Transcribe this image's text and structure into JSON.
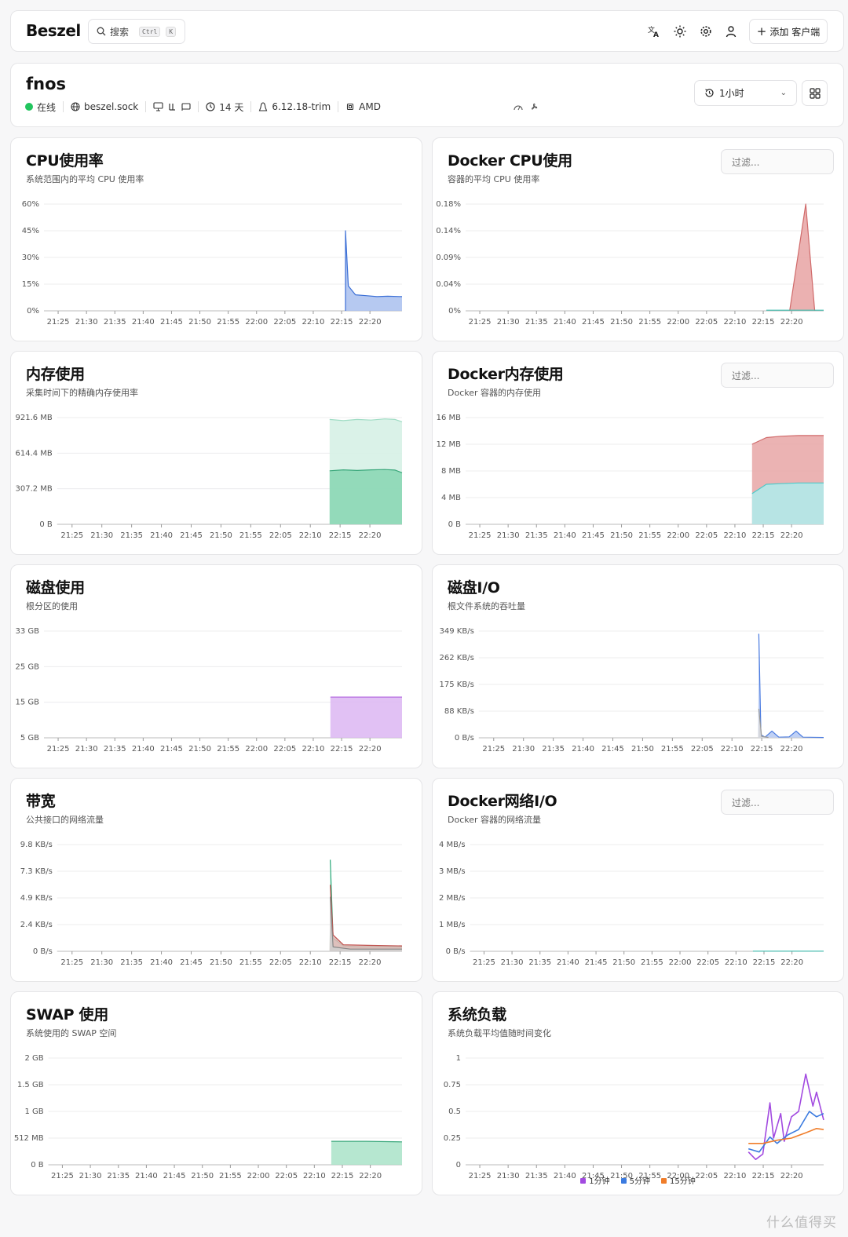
{
  "topbar": {
    "logo": "Beszel",
    "search_label": "搜索",
    "search_kbd_ctrl": "Ctrl",
    "search_kbd_k": "K",
    "add_client_label": "添加 客户端"
  },
  "system": {
    "hostname": "fnos",
    "status": "在线",
    "connection": "beszel.sock",
    "uptime": "14 天",
    "kernel": "6.12.18-trim",
    "cpu": "AMD",
    "time_range": "1小时"
  },
  "watermark": "什么值得买",
  "charts": [
    {
      "id": "cpu",
      "title": "CPU使用率",
      "subtitle": "系统范围内的平均 CPU 使用率",
      "filter": null
    },
    {
      "id": "docker_cpu",
      "title": "Docker CPU使用",
      "subtitle": "容器的平均 CPU 使用率",
      "filter": "过滤..."
    },
    {
      "id": "mem",
      "title": "内存使用",
      "subtitle": "采集时间下的精确内存使用率",
      "filter": null
    },
    {
      "id": "docker_mem",
      "title": "Docker内存使用",
      "subtitle": "Docker 容器的内存使用",
      "filter": "过滤..."
    },
    {
      "id": "disk",
      "title": "磁盘使用",
      "subtitle": "根分区的使用",
      "filter": null
    },
    {
      "id": "disk_io",
      "title": "磁盘I/O",
      "subtitle": "根文件系统的吞吐量",
      "filter": null
    },
    {
      "id": "bandwidth",
      "title": "带宽",
      "subtitle": "公共接口的网络流量",
      "filter": null
    },
    {
      "id": "docker_net",
      "title": "Docker网络I/O",
      "subtitle": "Docker 容器的网络流量",
      "filter": "过滤..."
    },
    {
      "id": "swap",
      "title": "SWAP 使用",
      "subtitle": "系统使用的 SWAP 空间",
      "filter": null
    },
    {
      "id": "load",
      "title": "系统负载",
      "subtitle": "系统负载平均值随时间变化",
      "filter": null
    }
  ],
  "chart_data": [
    {
      "type": "area",
      "id": "cpu",
      "xticks": [
        "21:25",
        "21:30",
        "21:35",
        "21:40",
        "21:45",
        "21:50",
        "21:55",
        "22:00",
        "22:05",
        "22:10",
        "22:15",
        "22:20"
      ],
      "yticks": [
        "60%",
        "45%",
        "30%",
        "15%",
        "0%"
      ],
      "ylim": [
        0,
        60
      ],
      "series": [
        {
          "color": "#3b6fd6",
          "fill": "#a9c0ee",
          "points": [
            [
              0.0,
              0
            ],
            [
              0.842,
              0
            ],
            [
              0.842,
              45
            ],
            [
              0.85,
              14
            ],
            [
              0.87,
              9
            ],
            [
              0.9,
              8.5
            ],
            [
              0.93,
              8
            ],
            [
              0.96,
              8.2
            ],
            [
              1.0,
              8
            ],
            [
              1.0,
              0
            ]
          ]
        }
      ]
    },
    {
      "type": "area",
      "id": "docker_cpu",
      "xticks": [
        "21:25",
        "21:30",
        "21:35",
        "21:40",
        "21:45",
        "21:50",
        "21:55",
        "22:00",
        "22:05",
        "22:10",
        "22:15",
        "22:20"
      ],
      "yticks": [
        "0.18%",
        "0.14%",
        "0.09%",
        "0.04%",
        "0%"
      ],
      "ylim": [
        0,
        0.18
      ],
      "series": [
        {
          "color": "#d06a6a",
          "fill": "#e8a3a3",
          "points": [
            [
              0.88,
              0
            ],
            [
              0.905,
              0
            ],
            [
              0.95,
              0.18
            ],
            [
              0.975,
              0
            ],
            [
              1.0,
              0
            ]
          ]
        },
        {
          "color": "#3fbfb0",
          "fill": "none",
          "points": [
            [
              0.84,
              0.001
            ],
            [
              1.0,
              0.001
            ]
          ]
        }
      ]
    },
    {
      "type": "area",
      "id": "mem",
      "xticks": [
        "21:25",
        "21:30",
        "21:35",
        "21:40",
        "21:45",
        "21:50",
        "21:55",
        "22:05",
        "22:10",
        "22:15",
        "22:20"
      ],
      "yticks": [
        "921.6 MB",
        "614.4 MB",
        "307.2 MB",
        "0 B"
      ],
      "ylim": [
        0,
        921.6
      ],
      "series": [
        {
          "color": "#9fdcc4",
          "fill": "#d3f0e4",
          "points": [
            [
              0.79,
              0
            ],
            [
              0.79,
              905
            ],
            [
              0.83,
              895
            ],
            [
              0.87,
              905
            ],
            [
              0.91,
              900
            ],
            [
              0.95,
              910
            ],
            [
              0.98,
              905
            ],
            [
              1.0,
              885
            ],
            [
              1.0,
              0
            ]
          ]
        },
        {
          "color": "#3aa77b",
          "fill": "#86d6b1",
          "points": [
            [
              0.79,
              0
            ],
            [
              0.79,
              462
            ],
            [
              0.83,
              470
            ],
            [
              0.87,
              465
            ],
            [
              0.91,
              470
            ],
            [
              0.95,
              473
            ],
            [
              0.98,
              468
            ],
            [
              1.0,
              445
            ],
            [
              1.0,
              0
            ]
          ]
        }
      ]
    },
    {
      "type": "area",
      "id": "docker_mem",
      "xticks": [
        "21:25",
        "21:30",
        "21:35",
        "21:40",
        "21:45",
        "21:50",
        "21:55",
        "22:00",
        "22:05",
        "22:10",
        "22:15",
        "22:20"
      ],
      "yticks": [
        "16 MB",
        "12 MB",
        "8 MB",
        "4 MB",
        "0 B"
      ],
      "ylim": [
        0,
        16
      ],
      "series": [
        {
          "color": "#d06a6a",
          "fill": "#e8a6a6",
          "points": [
            [
              0.8,
              0
            ],
            [
              0.8,
              12
            ],
            [
              0.84,
              13
            ],
            [
              0.88,
              13.2
            ],
            [
              0.93,
              13.3
            ],
            [
              1.0,
              13.3
            ],
            [
              1.0,
              0
            ]
          ]
        },
        {
          "color": "#4fc9c9",
          "fill": "#aeecec",
          "points": [
            [
              0.8,
              0
            ],
            [
              0.8,
              4.6
            ],
            [
              0.84,
              6
            ],
            [
              0.88,
              6.1
            ],
            [
              0.93,
              6.2
            ],
            [
              1.0,
              6.2
            ],
            [
              1.0,
              0
            ]
          ]
        }
      ]
    },
    {
      "type": "area",
      "id": "disk",
      "xticks": [
        "21:25",
        "21:30",
        "21:35",
        "21:40",
        "21:45",
        "21:50",
        "21:55",
        "22:00",
        "22:05",
        "22:10",
        "22:15",
        "22:20"
      ],
      "yticks": [
        "33 GB",
        "25 GB",
        "15 GB",
        "5 GB"
      ],
      "ylim": [
        0,
        33
      ],
      "series": [
        {
          "color": "#b46be0",
          "fill": "#dcb6f2",
          "points": [
            [
              0.8,
              0
            ],
            [
              0.8,
              12.6
            ],
            [
              1.0,
              12.6
            ],
            [
              1.0,
              0
            ]
          ]
        }
      ]
    },
    {
      "type": "area",
      "id": "disk_io",
      "xticks": [
        "21:25",
        "21:30",
        "21:35",
        "21:40",
        "21:45",
        "21:50",
        "21:55",
        "22:05",
        "22:10",
        "22:15",
        "22:20"
      ],
      "yticks": [
        "349 KB/s",
        "262 KB/s",
        "175 KB/s",
        "88 KB/s",
        "0 B/s"
      ],
      "ylim": [
        0,
        349
      ],
      "series": [
        {
          "color": "#4a7be0",
          "fill": "#b5c9f3",
          "points": [
            [
              0.81,
              0
            ],
            [
              0.812,
              340
            ],
            [
              0.818,
              10
            ],
            [
              0.83,
              2
            ],
            [
              0.85,
              22
            ],
            [
              0.87,
              2
            ],
            [
              0.9,
              3
            ],
            [
              0.92,
              22
            ],
            [
              0.94,
              2
            ],
            [
              1.0,
              1
            ]
          ]
        },
        {
          "color": "#9a9a9a",
          "fill": "#d8d8d8",
          "points": [
            [
              0.81,
              0
            ],
            [
              0.812,
              95
            ],
            [
              0.82,
              5
            ],
            [
              0.84,
              1
            ],
            [
              1.0,
              0
            ]
          ]
        }
      ]
    },
    {
      "type": "area",
      "id": "bandwidth",
      "xticks": [
        "21:25",
        "21:30",
        "21:35",
        "21:40",
        "21:45",
        "21:50",
        "21:55",
        "22:05",
        "22:10",
        "22:15",
        "22:20"
      ],
      "yticks": [
        "9.8 KB/s",
        "7.3 KB/s",
        "4.9 KB/s",
        "2.4 KB/s",
        "0 B/s"
      ],
      "ylim": [
        0,
        9.8
      ],
      "series": [
        {
          "color": "#2aa879",
          "fill": "#b8e6d2",
          "points": [
            [
              0.79,
              0
            ],
            [
              0.792,
              8.4
            ],
            [
              0.8,
              1.2
            ],
            [
              0.83,
              0.5
            ],
            [
              0.88,
              0.4
            ],
            [
              0.93,
              0.45
            ],
            [
              1.0,
              0.4
            ],
            [
              1.0,
              0
            ]
          ]
        },
        {
          "color": "#c0504d",
          "fill": "#e3b8b6",
          "points": [
            [
              0.79,
              0
            ],
            [
              0.792,
              6.1
            ],
            [
              0.8,
              1.5
            ],
            [
              0.83,
              0.6
            ],
            [
              0.9,
              0.55
            ],
            [
              1.0,
              0.5
            ],
            [
              1.0,
              0
            ]
          ]
        },
        {
          "color": "#888",
          "fill": "#d0d0d0",
          "points": [
            [
              0.79,
              0
            ],
            [
              0.792,
              5
            ],
            [
              0.8,
              0.4
            ],
            [
              0.85,
              0.2
            ],
            [
              1.0,
              0.2
            ],
            [
              1.0,
              0
            ]
          ]
        }
      ]
    },
    {
      "type": "area",
      "id": "docker_net",
      "xticks": [
        "21:25",
        "21:30",
        "21:35",
        "21:40",
        "21:45",
        "21:50",
        "21:55",
        "22:00",
        "22:05",
        "22:10",
        "22:15",
        "22:20"
      ],
      "yticks": [
        "4 MB/s",
        "3 MB/s",
        "2 MB/s",
        "1 MB/s",
        "0 B/s"
      ],
      "ylim": [
        0,
        4
      ],
      "series": [
        {
          "color": "#3fbfb0",
          "fill": "none",
          "points": [
            [
              0.8,
              0.005
            ],
            [
              1.0,
              0.005
            ]
          ]
        }
      ]
    },
    {
      "type": "area",
      "id": "swap",
      "xticks": [
        "21:25",
        "21:30",
        "21:35",
        "21:40",
        "21:45",
        "21:50",
        "21:55",
        "22:00",
        "22:05",
        "22:10",
        "22:15",
        "22:20"
      ],
      "yticks": [
        "2 GB",
        "1.5 GB",
        "1 GB",
        "512 MB",
        "0 B"
      ],
      "ylim": [
        0,
        2
      ],
      "series": [
        {
          "color": "#3aa77b",
          "fill": "#a9e3c8",
          "points": [
            [
              0.8,
              0
            ],
            [
              0.8,
              0.44
            ],
            [
              0.9,
              0.44
            ],
            [
              1.0,
              0.43
            ],
            [
              1.0,
              0
            ]
          ]
        }
      ]
    },
    {
      "type": "line",
      "id": "load",
      "xticks": [
        "21:25",
        "21:30",
        "21:35",
        "21:40",
        "21:45",
        "21:50",
        "21:55",
        "22:00",
        "22:05",
        "22:10",
        "22:15",
        "22:20"
      ],
      "yticks": [
        "1",
        "0.75",
        "0.5",
        "0.25",
        "0"
      ],
      "ylim": [
        0,
        1
      ],
      "legend": [
        {
          "name": "1分钟",
          "color": "#a24ae0"
        },
        {
          "name": "5分钟",
          "color": "#3b7be0"
        },
        {
          "name": "15分钟",
          "color": "#f07d2a"
        }
      ],
      "series": [
        {
          "color": "#a24ae0",
          "fill": "none",
          "points": [
            [
              0.79,
              0.12
            ],
            [
              0.81,
              0.05
            ],
            [
              0.83,
              0.1
            ],
            [
              0.85,
              0.58
            ],
            [
              0.86,
              0.25
            ],
            [
              0.88,
              0.48
            ],
            [
              0.89,
              0.22
            ],
            [
              0.91,
              0.45
            ],
            [
              0.93,
              0.5
            ],
            [
              0.95,
              0.85
            ],
            [
              0.97,
              0.55
            ],
            [
              0.98,
              0.68
            ],
            [
              1.0,
              0.42
            ]
          ]
        },
        {
          "color": "#3b7be0",
          "fill": "none",
          "points": [
            [
              0.79,
              0.15
            ],
            [
              0.82,
              0.12
            ],
            [
              0.85,
              0.26
            ],
            [
              0.87,
              0.2
            ],
            [
              0.9,
              0.28
            ],
            [
              0.93,
              0.33
            ],
            [
              0.96,
              0.5
            ],
            [
              0.98,
              0.45
            ],
            [
              1.0,
              0.48
            ]
          ]
        },
        {
          "color": "#f07d2a",
          "fill": "none",
          "points": [
            [
              0.79,
              0.2
            ],
            [
              0.83,
              0.2
            ],
            [
              0.87,
              0.23
            ],
            [
              0.91,
              0.25
            ],
            [
              0.95,
              0.3
            ],
            [
              0.98,
              0.34
            ],
            [
              1.0,
              0.33
            ]
          ]
        }
      ]
    }
  ]
}
